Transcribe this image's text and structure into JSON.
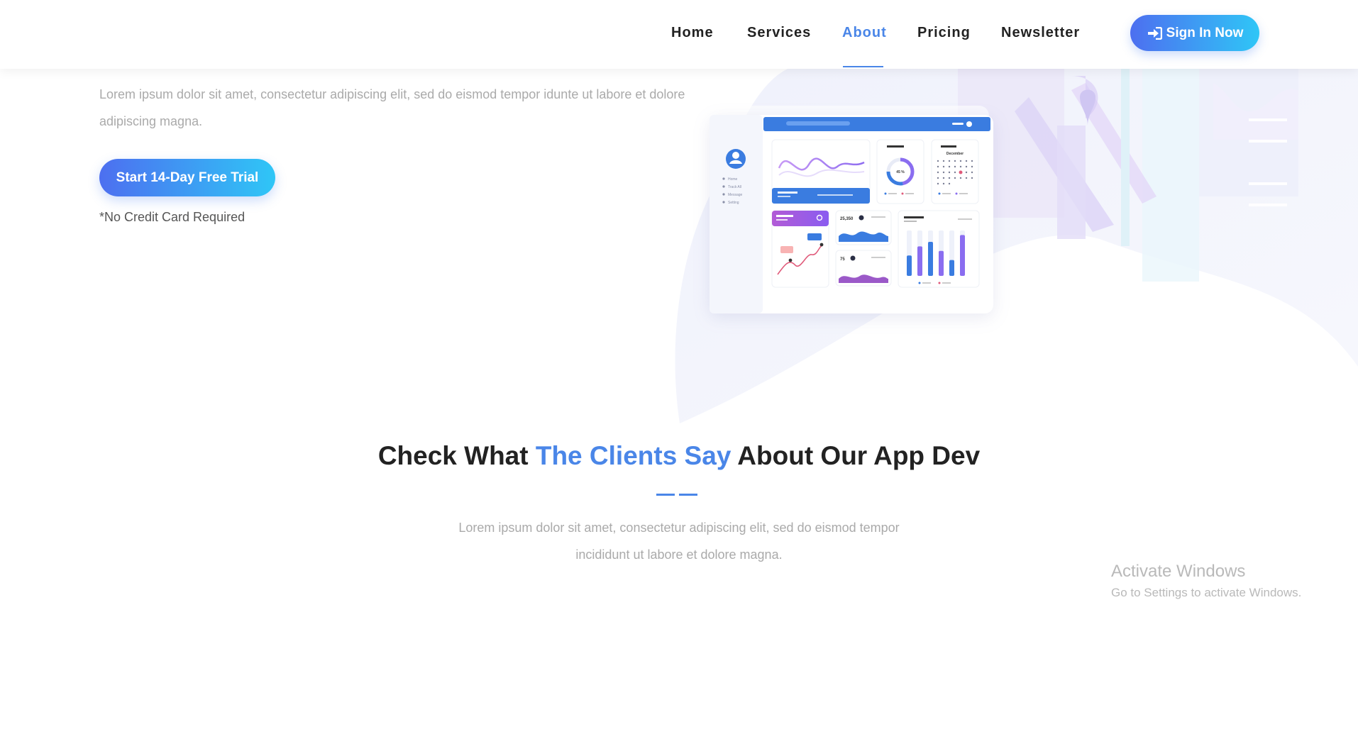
{
  "nav": {
    "items": [
      {
        "label": "Home"
      },
      {
        "label": "Services"
      },
      {
        "label": "About"
      },
      {
        "label": "Pricing"
      },
      {
        "label": "Newsletter"
      }
    ],
    "active": "About",
    "signin_label": "Sign In Now"
  },
  "hero": {
    "text": "Lorem ipsum dolor sit amet, consectetur adipiscing elit, sed do eismod tempor idunte ut labore et dolore adipiscing magna.",
    "cta_label": "Start 14-Day Free Trial",
    "note": "*No Credit Card Required",
    "mockup": {
      "sidebar_items": [
        "Home",
        "Track All",
        "Message",
        "Setting"
      ],
      "donut_percent": "45 %",
      "calendar_title": "December",
      "stat_1": "25,350",
      "stat_2": "75",
      "bar_values": [
        0.45,
        0.65,
        0.75,
        0.55,
        0.35,
        0.9
      ]
    }
  },
  "testimonials": {
    "title_before": "Check What ",
    "title_highlight": "The Clients Say",
    "title_after": " About Our App Dev",
    "text": "Lorem ipsum dolor sit amet, consectetur adipiscing elit, sed do eismod tempor incididunt ut labore et dolore magna."
  },
  "watermark": {
    "title": "Activate Windows",
    "subtitle": "Go to Settings to activate Windows."
  },
  "colors": {
    "accent": "#4a86e8",
    "gradient_start": "#4d6ff0",
    "gradient_end": "#2fc6f6",
    "muted_text": "#aaaaaa"
  }
}
